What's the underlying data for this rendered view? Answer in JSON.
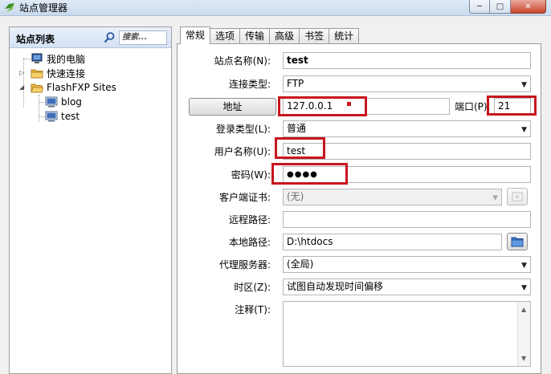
{
  "window": {
    "title": "站点管理器",
    "min_glyph": "─",
    "max_glyph": "□",
    "close_glyph": "✕"
  },
  "sidebar": {
    "title": "站点列表",
    "search_placeholder": "搜索...",
    "tree": {
      "my_computer": "我的电脑",
      "quick_connect": "快速连接",
      "flashfxp_sites": "FlashFXP Sites",
      "sites": [
        "blog",
        "test"
      ]
    }
  },
  "tabs": [
    "常规",
    "选项",
    "传输",
    "高级",
    "书签",
    "统计"
  ],
  "form": {
    "site_name_label": "站点名称(N):",
    "site_name_value": "test",
    "conn_type_label": "连接类型:",
    "conn_type_value": "FTP",
    "address_button": "地址",
    "address_value": "127.0.0.1",
    "port_label": "端口(P):",
    "port_value": "21",
    "login_type_label": "登录类型(L):",
    "login_type_value": "普通",
    "username_label": "用户名称(U):",
    "username_value": "test",
    "password_label": "密码(W):",
    "password_value": "●●●●",
    "client_cert_label": "客户端证书:",
    "client_cert_value": "(无)",
    "remote_path_label": "远程路径:",
    "remote_path_value": "",
    "local_path_label": "本地路径:",
    "local_path_value": "D:\\htdocs",
    "proxy_label": "代理服务器:",
    "proxy_value": "(全局)",
    "timezone_label": "时区(Z):",
    "timezone_value": "试图自动发现时间偏移",
    "notes_label": "注释(T):",
    "notes_value": ""
  },
  "colors": {
    "highlight_red": "#c8141e"
  }
}
